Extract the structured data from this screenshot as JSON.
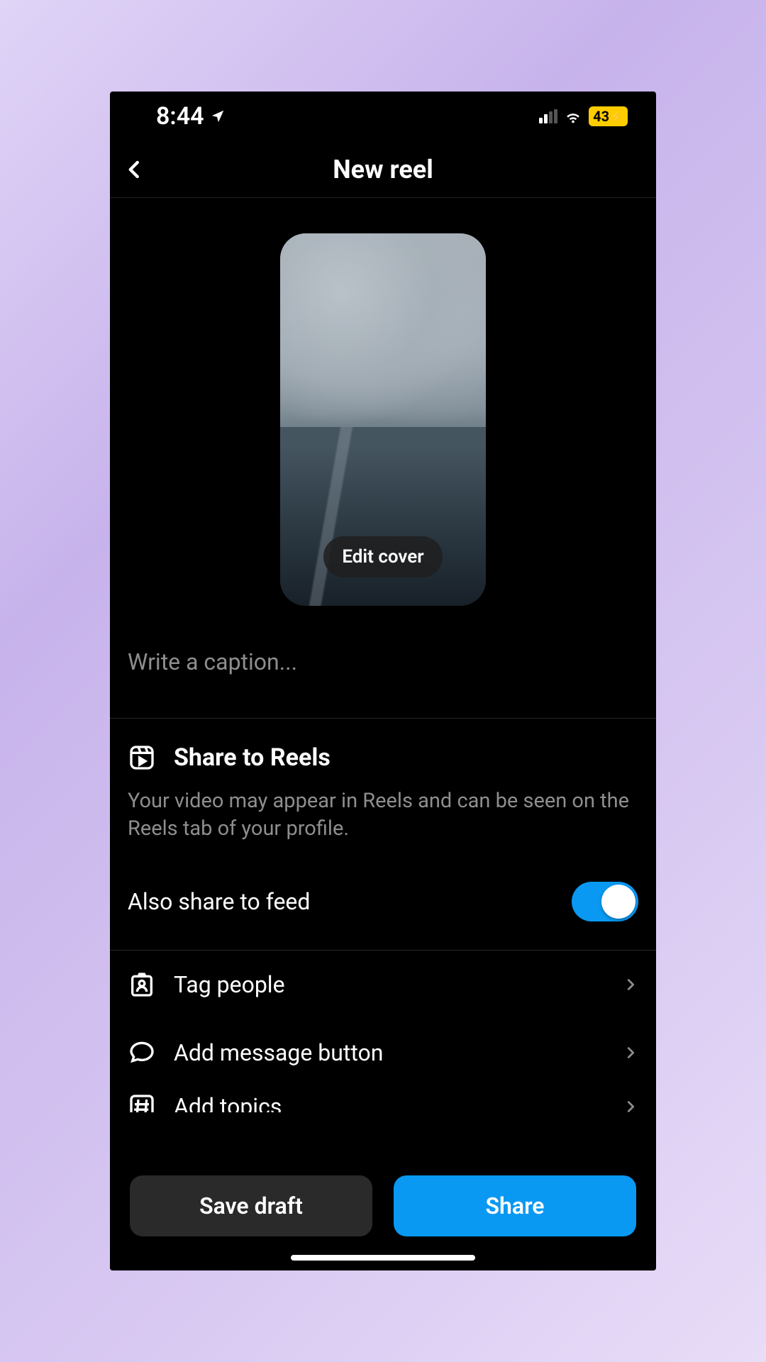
{
  "status": {
    "time": "8:44",
    "battery": "43"
  },
  "header": {
    "title": "New reel"
  },
  "cover": {
    "edit_label": "Edit cover"
  },
  "caption": {
    "placeholder": "Write a caption..."
  },
  "share_section": {
    "title": "Share to Reels",
    "description": "Your video may appear in Reels and can be seen on the Reels tab of your profile.",
    "toggle_label": "Also share to feed"
  },
  "options": [
    {
      "label": "Tag people",
      "icon": "tag-person-icon"
    },
    {
      "label": "Add message button",
      "icon": "message-icon"
    },
    {
      "label": "Add topics",
      "icon": "hashtag-icon"
    }
  ],
  "footer": {
    "draft_label": "Save draft",
    "share_label": "Share"
  }
}
